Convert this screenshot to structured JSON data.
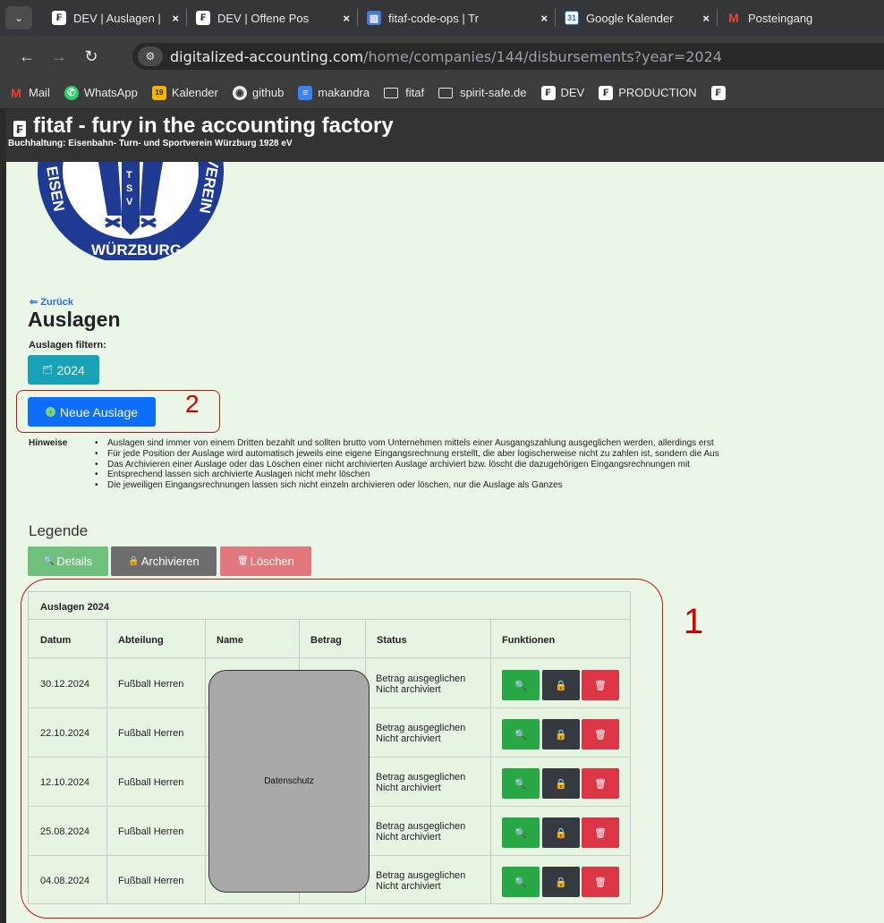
{
  "browser": {
    "tabs": [
      {
        "label": "DEV | Auslagen |",
        "favicon": "fitaf-icon"
      },
      {
        "label": "DEV | Offene Pos",
        "favicon": "fitaf-icon"
      },
      {
        "label": "fitaf-code-ops | Tr",
        "favicon": "trello-icon"
      },
      {
        "label": "Google Kalender",
        "favicon": "calendar-icon"
      },
      {
        "label": "Posteingang",
        "favicon": "gmail-icon"
      }
    ],
    "url_host": "digitalized-accounting.com",
    "url_path": "/home/companies/144/disbursements?year=2024",
    "bookmarks": [
      {
        "label": "Mail",
        "icon": "gmail-icon"
      },
      {
        "label": "WhatsApp",
        "icon": "whatsapp-icon"
      },
      {
        "label": "Kalender",
        "icon": "calendar-icon"
      },
      {
        "label": "github",
        "icon": "github-icon"
      },
      {
        "label": "makandra",
        "icon": "makandra-icon"
      },
      {
        "label": "fitaf",
        "icon": "folder-icon"
      },
      {
        "label": "spirit-safe.de",
        "icon": "folder-icon"
      },
      {
        "label": "DEV",
        "icon": "fitaf-icon"
      },
      {
        "label": "PRODUCTION",
        "icon": "fitaf-icon"
      }
    ]
  },
  "app": {
    "title": "fitaf - fury in the accounting factory",
    "subtitle": "Buchhaltung: Eisenbahn- Turn- und Sportverein Würzburg 1928 eV"
  },
  "page": {
    "back_label": "Zurück",
    "title": "Auslagen",
    "filter_label": "Auslagen filtern:",
    "year_button": "2024",
    "new_button": "Neue Auslage",
    "hints_label": "Hinweise",
    "hints": [
      "Auslagen sind immer von einem Dritten bezahlt und sollten brutto vom Unternehmen mittels einer Ausgangszahlung ausgeglichen werden, allerdings erst",
      "Für jede Position der Auslage wird automatisch jeweils eine eigene Eingangsrechnung erstellt, die aber logischerweise nicht zu zahlen ist, sondern die Aus",
      "Das Archivieren einer Auslage oder das Löschen einer nicht archivierten Auslage archiviert bzw. löscht die dazugehörigen Eingangsrechnungen mit",
      "Entsprechend lassen sich archivierte Auslagen nicht mehr löschen",
      "Die jeweiligen Eingangsrechnungen lassen sich nicht einzeln archivieren oder löschen, nur die Auslage als Ganzes"
    ],
    "legend_title": "Legende",
    "legend": {
      "details": "Details",
      "archive": "Archivieren",
      "delete": "Löschen"
    }
  },
  "table": {
    "caption": "Auslagen 2024",
    "headers": [
      "Datum",
      "Abteilung",
      "Name",
      "Betrag",
      "Status",
      "Funktionen"
    ],
    "rows": [
      {
        "date": "30.12.2024",
        "department": "Fußball Herren",
        "status1": "Betrag ausgeglichen",
        "status2": "Nicht archiviert"
      },
      {
        "date": "22.10.2024",
        "department": "Fußball Herren",
        "status1": "Betrag ausgeglichen",
        "status2": "Nicht archiviert"
      },
      {
        "date": "12.10.2024",
        "department": "Fußball Herren",
        "status1": "Betrag ausgeglichen",
        "status2": "Nicht archiviert"
      },
      {
        "date": "25.08.2024",
        "department": "Fußball Herren",
        "status1": "Betrag ausgeglichen",
        "status2": "Nicht archiviert"
      },
      {
        "date": "04.08.2024",
        "department": "Fußball Herren",
        "status1": "Betrag ausgeglichen",
        "status2": "Nicht archiviert"
      }
    ],
    "privacy_label": "Datenschutz"
  },
  "annotations": {
    "marker1": "1",
    "marker2": "2"
  },
  "logo_text": {
    "top_left": "EISEN",
    "bottom": "WÜRZBURG",
    "right": "VEREIN",
    "center": "TSV"
  },
  "colors": {
    "details": "#28a745",
    "archive": "#343a40",
    "delete": "#dc3545",
    "primary": "#0d6efd",
    "info": "#17a2b8",
    "annotation": "#d10000"
  }
}
